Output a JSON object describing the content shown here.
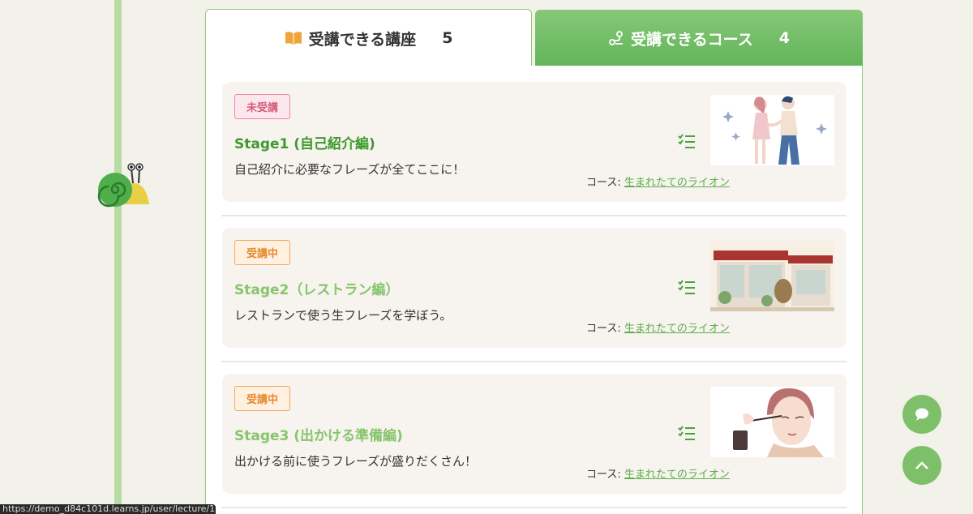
{
  "tabs": {
    "lectures": {
      "label": "受講できる講座",
      "count": "5"
    },
    "courses": {
      "label": "受講できるコース",
      "count": "4"
    }
  },
  "course_prefix": "コース:",
  "lectures": [
    {
      "status": "未受講",
      "title": "Stage1 (自己紹介編)",
      "description": "自己紹介に必要なフレーズが全てここに！",
      "course": "生まれたてのライオン",
      "image": "handshake-illustration"
    },
    {
      "status": "受講中",
      "title": "Stage2（レストラン編）",
      "description": "レストランで使う生フレーズを学ぼう。",
      "course": "生まれたてのライオン",
      "image": "restaurant-illustration"
    },
    {
      "status": "受講中",
      "title": "Stage3 (出かける準備編)",
      "description": "出かける前に使うフレーズが盛りだくさん！",
      "course": "生まれたてのライオン",
      "image": "makeup-illustration"
    }
  ],
  "status_url": "https://demo_d84c101d.learns.jp/user/lecture/12",
  "colors": {
    "accent": "#63b45a",
    "timeline": "#b7dba2",
    "card": "#f7f3ee"
  }
}
